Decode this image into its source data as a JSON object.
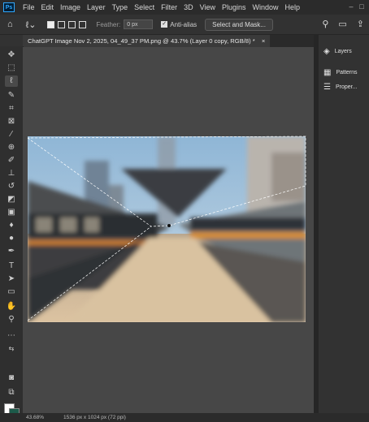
{
  "menubar": {
    "logo": "Ps",
    "items": [
      "File",
      "Edit",
      "Image",
      "Layer",
      "Type",
      "Select",
      "Filter",
      "3D",
      "View",
      "Plugins",
      "Window",
      "Help"
    ]
  },
  "options_bar": {
    "feather_label": "Feather:",
    "feather_value": "0 px",
    "anti_alias_label": "Anti-alias",
    "select_mask_label": "Select and Mask..."
  },
  "document": {
    "tab_title": "ChatGPT Image Nov 2, 2025, 04_49_37 PM.png @ 43.7% (Layer 0 copy, RGB/8) *",
    "close_symbol": "×"
  },
  "panels": {
    "layers": "Layers",
    "patterns": "Patterns",
    "properties": "Proper..."
  },
  "status": {
    "zoom": "43.68%",
    "doc_size": "1536 px x 1024 px (72 ppi)"
  },
  "colors": {
    "accent": "#31a8ff",
    "foreground_swatch": "#ffffff",
    "background_swatch": "#1d5a4a"
  }
}
